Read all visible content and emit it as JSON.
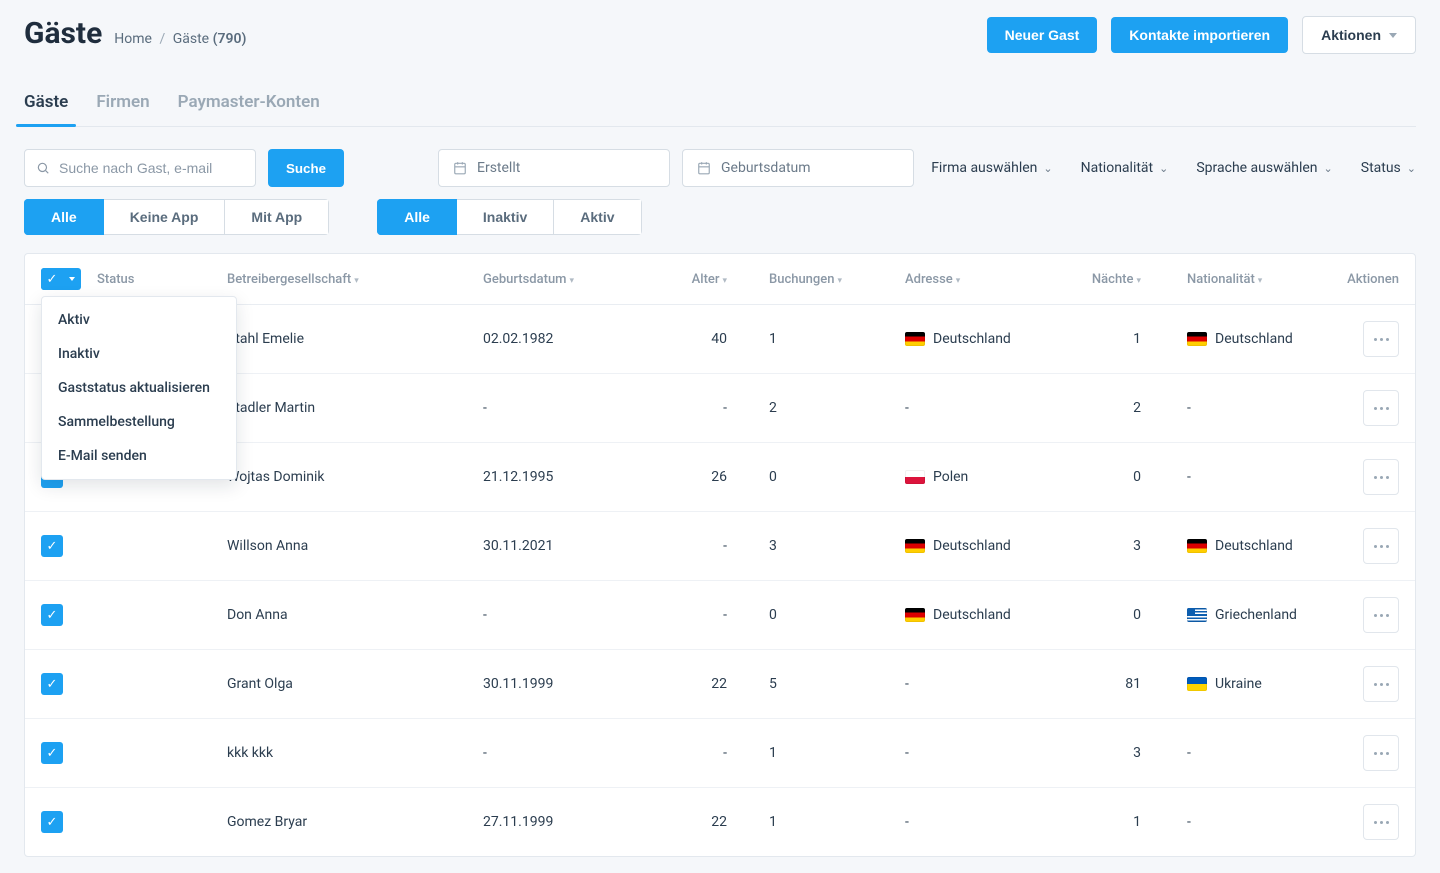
{
  "header": {
    "title": "Gäste",
    "breadcrumb_home": "Home",
    "breadcrumb_guests": "Gäste",
    "count": "(790)",
    "btn_new": "Neuer Gast",
    "btn_import": "Kontakte importieren",
    "btn_actions": "Aktionen"
  },
  "tabs": {
    "guests": "Gäste",
    "companies": "Firmen",
    "paymaster": "Paymaster-Konten"
  },
  "filters": {
    "search_placeholder": "Suche nach Gast, e-mail",
    "search_btn": "Suche",
    "created": "Erstellt",
    "birthdate": "Geburtsdatum",
    "company": "Firma auswählen",
    "nationality": "Nationalität",
    "language": "Sprache auswählen",
    "status": "Status"
  },
  "segments": {
    "app": {
      "all": "Alle",
      "no_app": "Keine App",
      "with_app": "Mit App"
    },
    "status": {
      "all": "Alle",
      "inactive": "Inaktiv",
      "active": "Aktiv"
    }
  },
  "columns": {
    "status": "Status",
    "company": "Betreibergesellschaft",
    "birthdate": "Geburtsdatum",
    "age": "Alter",
    "bookings": "Buchungen",
    "address": "Adresse",
    "nights": "Nächte",
    "nationality": "Nationalität",
    "actions": "Aktionen"
  },
  "dropdown": {
    "active": "Aktiv",
    "inactive": "Inaktiv",
    "update_status": "Gaststatus aktualisieren",
    "bulk_order": "Sammelbestellung",
    "send_email": "E-Mail senden"
  },
  "rows": [
    {
      "name": "Stahl Emelie",
      "birth": "02.02.1982",
      "age": "40",
      "book": "1",
      "addr": "Deutschland",
      "addr_flag": "de",
      "nights": "1",
      "nat": "Deutschland",
      "nat_flag": "de"
    },
    {
      "name": "Stadler Martin",
      "birth": "-",
      "age": "-",
      "book": "2",
      "addr": "-",
      "addr_flag": "",
      "nights": "2",
      "nat": "-",
      "nat_flag": ""
    },
    {
      "name": "Wojtas Dominik",
      "birth": "21.12.1995",
      "age": "26",
      "book": "0",
      "addr": "Polen",
      "addr_flag": "pl",
      "nights": "0",
      "nat": "-",
      "nat_flag": ""
    },
    {
      "name": "Willson Anna",
      "birth": "30.11.2021",
      "age": "-",
      "book": "3",
      "addr": "Deutschland",
      "addr_flag": "de",
      "nights": "3",
      "nat": "Deutschland",
      "nat_flag": "de"
    },
    {
      "name": "Don Anna",
      "birth": "-",
      "age": "-",
      "book": "0",
      "addr": "Deutschland",
      "addr_flag": "de",
      "nights": "0",
      "nat": "Griechenland",
      "nat_flag": "gr"
    },
    {
      "name": "Grant Olga",
      "birth": "30.11.1999",
      "age": "22",
      "book": "5",
      "addr": "-",
      "addr_flag": "",
      "nights": "81",
      "nat": "Ukraine",
      "nat_flag": "ua"
    },
    {
      "name": "kkk kkk",
      "birth": "-",
      "age": "-",
      "book": "1",
      "addr": "-",
      "addr_flag": "",
      "nights": "3",
      "nat": "-",
      "nat_flag": ""
    },
    {
      "name": "Gomez Bryar",
      "birth": "27.11.1999",
      "age": "22",
      "book": "1",
      "addr": "-",
      "addr_flag": "",
      "nights": "1",
      "nat": "-",
      "nat_flag": ""
    }
  ]
}
